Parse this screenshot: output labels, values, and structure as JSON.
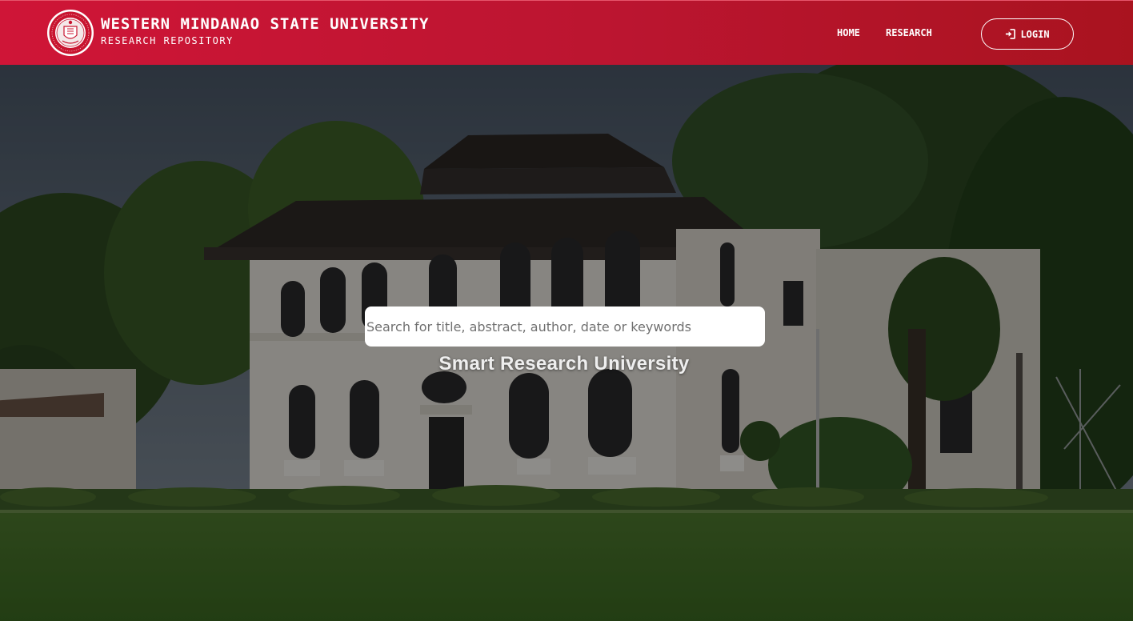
{
  "header": {
    "title": "WESTERN MINDANAO STATE UNIVERSITY",
    "subtitle": "RESEARCH REPOSITORY",
    "logo_icon": "university-seal",
    "bg_color": "#c01530"
  },
  "nav": {
    "home": "HOME",
    "research": "RESEARCH",
    "login": "LOGIN",
    "login_icon": "sign-in-icon"
  },
  "hero": {
    "search_placeholder": "Search for title, abstract, author, date or keywords",
    "search_value": "",
    "tagline": "Smart Research University"
  }
}
